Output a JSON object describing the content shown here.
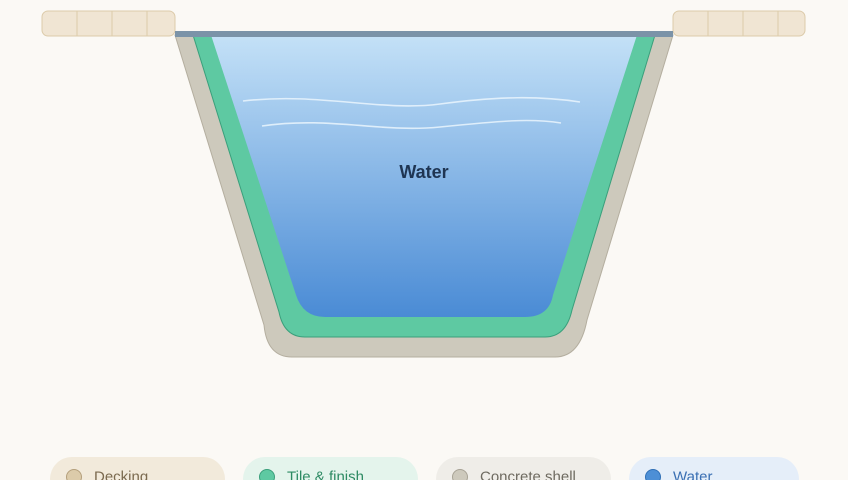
{
  "diagram": {
    "water_label": "Water"
  },
  "legend": [
    {
      "label": "Decking",
      "color": "#dccbaa"
    },
    {
      "label": "Tile & finish",
      "color": "#5ec9a2"
    },
    {
      "label": "Concrete shell",
      "color": "#cdc9bc"
    },
    {
      "label": "Water",
      "color": "#4d8fd6"
    }
  ],
  "colors": {
    "background": "#fbf9f5",
    "decking": "#f0e5d3",
    "coping": "#7b93a8",
    "tile": "#5ec9a2",
    "shell": "#cdc9bc",
    "water_top": "#c4e1f7",
    "water_bottom": "#4a8bd5"
  }
}
